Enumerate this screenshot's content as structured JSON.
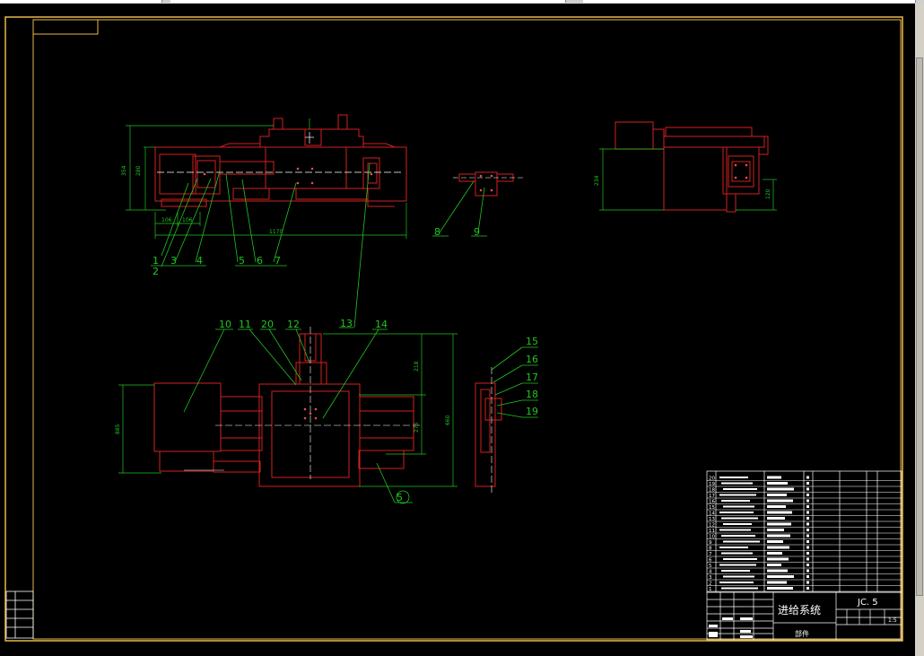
{
  "drawing": {
    "title_cn": "进给系统",
    "drawing_no": "JC. 5",
    "part_label": "部件",
    "scale": "1:5",
    "colors": {
      "frame": "#e8b84a",
      "part": "#d42020",
      "leader": "#22c422",
      "dim": "#22c422",
      "hatch": "#ffffff",
      "background": "#000000"
    }
  },
  "dimensions": {
    "top_view_height_outer": "354",
    "top_view_height_inner": "280",
    "top_view_width": "1170",
    "top_view_w1": "106",
    "top_view_w2": "106",
    "side_view_height": "234",
    "side_view_offset": "120",
    "front_view_left_height": "885",
    "front_view_upper": "218",
    "front_view_mid": "275",
    "front_view_total": "660"
  },
  "balloons": [
    "1",
    "2",
    "3",
    "4",
    "5",
    "6",
    "7",
    "8",
    "9",
    "10",
    "11",
    "20",
    "12",
    "13",
    "14",
    "15",
    "16",
    "17",
    "18",
    "19",
    "5"
  ],
  "parts_list": {
    "numbers": [
      "20",
      "19",
      "18",
      "17",
      "16",
      "15",
      "14",
      "13",
      "12",
      "11",
      "10",
      "9",
      "8",
      "7",
      "6",
      "5",
      "4",
      "3",
      "2",
      "1"
    ]
  }
}
